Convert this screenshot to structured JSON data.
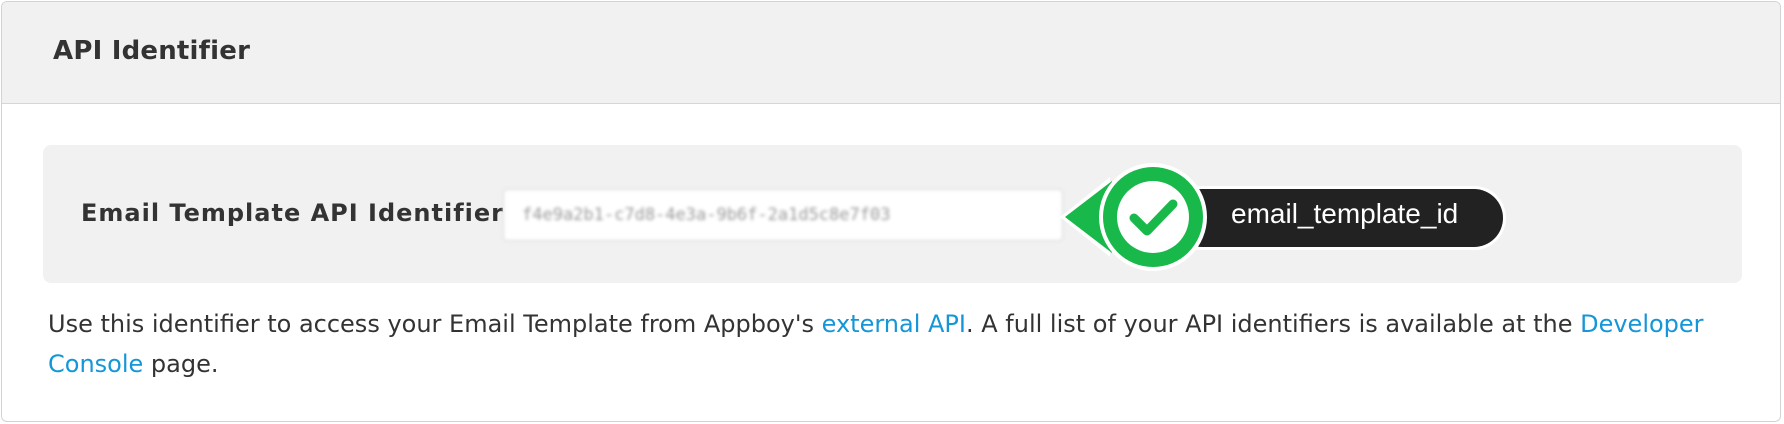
{
  "panel": {
    "title": "API Identifier"
  },
  "field": {
    "label": "Email Template API Identifier:",
    "value": "f4e9a2b1-c7d8-4e3a-9b6f-2a1d5c8e7f03"
  },
  "callout": {
    "icon": "checkmark-icon",
    "label": "email_template_id",
    "colors": {
      "accent": "#19b84a",
      "badge": "#222222"
    }
  },
  "description": {
    "text_before": "Use this identifier to access your Email Template from Appboy's ",
    "link_external_api": "external API",
    "text_middle": ". A full list of your API identifiers is available at the ",
    "link_developer_console": "Developer Console",
    "text_after": " page."
  },
  "colors": {
    "link": "#1496d8",
    "header_bg": "#f1f1f1"
  }
}
